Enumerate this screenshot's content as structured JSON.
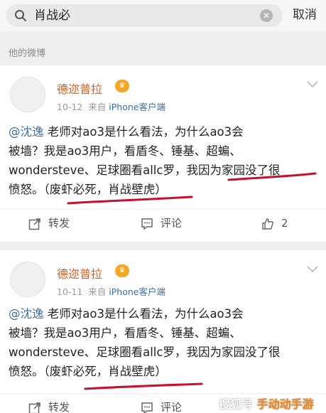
{
  "search": {
    "query": "肖战必",
    "cancel_label": "取消"
  },
  "section_title": "他的微博",
  "posts": [
    {
      "username": "德迩普拉",
      "date": "10-12",
      "via": "来自",
      "source": "iPhone客户端",
      "mention": "@沈逸",
      "lines": [
        " 老师对ao3是什么看法，为什么ao3会",
        "被墙？我是ao3用户，看盾冬、锤基、超蝙、",
        "wondersteve、足球圈看allc罗，我因为家园没了很",
        "愤怒。（废虾必死，肖战壁虎）"
      ],
      "repost_label": "转发",
      "comment_label": "评论",
      "like_count": "2"
    },
    {
      "username": "德迩普拉",
      "date": "10-11",
      "via": "来自",
      "source": "iPhone客户端",
      "mention": "@沈逸",
      "lines": [
        " 老师对ao3是什么看法，为什么ao3会",
        "被墙？我是ao3用户，看盾冬、锤基、超蝙、",
        "wondersteve、足球圈看allc罗，我因为家园没了很",
        "愤怒。（废虾必死，肖战壁虎）"
      ],
      "repost_label": "转发",
      "comment_label": "评论"
    }
  ],
  "watermark": {
    "prefix": "搜狐号",
    "brand": "手动动手游"
  },
  "colors": {
    "username": "#e05d1f",
    "link": "#3f6fa8",
    "underline": "#c8102e"
  }
}
